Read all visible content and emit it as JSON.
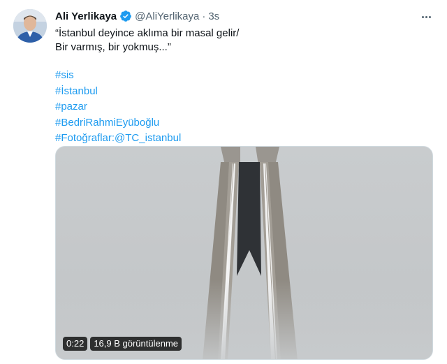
{
  "author": {
    "display_name": "Ali Yerlikaya",
    "handle": "@AliYerlikaya",
    "separator": "·",
    "time": "3s",
    "verified": true
  },
  "tweet": {
    "text_lines": [
      "“İstanbul deyince aklıma bir masal gelir/",
      "Bir varmış, bir yokmuş...”"
    ],
    "hashtags": [
      "#sis",
      "#İstanbul",
      "#pazar",
      "#BedriRahmiEyüboğlu"
    ],
    "credit_prefix": "#Fotoğraflar:",
    "credit_mention": "@TC_istanbul"
  },
  "media": {
    "type": "video",
    "duration": "0:22",
    "views": "16,9 B görüntülenme"
  },
  "icons": {
    "verified": "verified-badge-icon",
    "more": "more-options-icon"
  },
  "colors": {
    "accent": "#1d9bf0",
    "text": "#0f1419",
    "muted": "#536471"
  }
}
